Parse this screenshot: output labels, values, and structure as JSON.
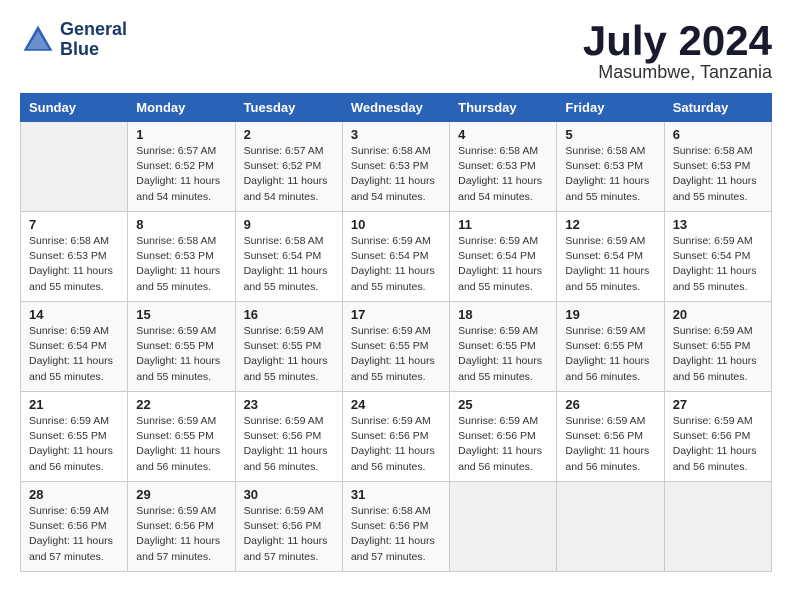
{
  "header": {
    "logo_line1": "General",
    "logo_line2": "Blue",
    "month_year": "July 2024",
    "location": "Masumbwe, Tanzania"
  },
  "calendar": {
    "days_of_week": [
      "Sunday",
      "Monday",
      "Tuesday",
      "Wednesday",
      "Thursday",
      "Friday",
      "Saturday"
    ],
    "weeks": [
      [
        {
          "day": "",
          "info": ""
        },
        {
          "day": "1",
          "info": "Sunrise: 6:57 AM\nSunset: 6:52 PM\nDaylight: 11 hours\nand 54 minutes."
        },
        {
          "day": "2",
          "info": "Sunrise: 6:57 AM\nSunset: 6:52 PM\nDaylight: 11 hours\nand 54 minutes."
        },
        {
          "day": "3",
          "info": "Sunrise: 6:58 AM\nSunset: 6:53 PM\nDaylight: 11 hours\nand 54 minutes."
        },
        {
          "day": "4",
          "info": "Sunrise: 6:58 AM\nSunset: 6:53 PM\nDaylight: 11 hours\nand 54 minutes."
        },
        {
          "day": "5",
          "info": "Sunrise: 6:58 AM\nSunset: 6:53 PM\nDaylight: 11 hours\nand 55 minutes."
        },
        {
          "day": "6",
          "info": "Sunrise: 6:58 AM\nSunset: 6:53 PM\nDaylight: 11 hours\nand 55 minutes."
        }
      ],
      [
        {
          "day": "7",
          "info": "Sunrise: 6:58 AM\nSunset: 6:53 PM\nDaylight: 11 hours\nand 55 minutes."
        },
        {
          "day": "8",
          "info": "Sunrise: 6:58 AM\nSunset: 6:53 PM\nDaylight: 11 hours\nand 55 minutes."
        },
        {
          "day": "9",
          "info": "Sunrise: 6:58 AM\nSunset: 6:54 PM\nDaylight: 11 hours\nand 55 minutes."
        },
        {
          "day": "10",
          "info": "Sunrise: 6:59 AM\nSunset: 6:54 PM\nDaylight: 11 hours\nand 55 minutes."
        },
        {
          "day": "11",
          "info": "Sunrise: 6:59 AM\nSunset: 6:54 PM\nDaylight: 11 hours\nand 55 minutes."
        },
        {
          "day": "12",
          "info": "Sunrise: 6:59 AM\nSunset: 6:54 PM\nDaylight: 11 hours\nand 55 minutes."
        },
        {
          "day": "13",
          "info": "Sunrise: 6:59 AM\nSunset: 6:54 PM\nDaylight: 11 hours\nand 55 minutes."
        }
      ],
      [
        {
          "day": "14",
          "info": "Sunrise: 6:59 AM\nSunset: 6:54 PM\nDaylight: 11 hours\nand 55 minutes."
        },
        {
          "day": "15",
          "info": "Sunrise: 6:59 AM\nSunset: 6:55 PM\nDaylight: 11 hours\nand 55 minutes."
        },
        {
          "day": "16",
          "info": "Sunrise: 6:59 AM\nSunset: 6:55 PM\nDaylight: 11 hours\nand 55 minutes."
        },
        {
          "day": "17",
          "info": "Sunrise: 6:59 AM\nSunset: 6:55 PM\nDaylight: 11 hours\nand 55 minutes."
        },
        {
          "day": "18",
          "info": "Sunrise: 6:59 AM\nSunset: 6:55 PM\nDaylight: 11 hours\nand 55 minutes."
        },
        {
          "day": "19",
          "info": "Sunrise: 6:59 AM\nSunset: 6:55 PM\nDaylight: 11 hours\nand 56 minutes."
        },
        {
          "day": "20",
          "info": "Sunrise: 6:59 AM\nSunset: 6:55 PM\nDaylight: 11 hours\nand 56 minutes."
        }
      ],
      [
        {
          "day": "21",
          "info": "Sunrise: 6:59 AM\nSunset: 6:55 PM\nDaylight: 11 hours\nand 56 minutes."
        },
        {
          "day": "22",
          "info": "Sunrise: 6:59 AM\nSunset: 6:55 PM\nDaylight: 11 hours\nand 56 minutes."
        },
        {
          "day": "23",
          "info": "Sunrise: 6:59 AM\nSunset: 6:56 PM\nDaylight: 11 hours\nand 56 minutes."
        },
        {
          "day": "24",
          "info": "Sunrise: 6:59 AM\nSunset: 6:56 PM\nDaylight: 11 hours\nand 56 minutes."
        },
        {
          "day": "25",
          "info": "Sunrise: 6:59 AM\nSunset: 6:56 PM\nDaylight: 11 hours\nand 56 minutes."
        },
        {
          "day": "26",
          "info": "Sunrise: 6:59 AM\nSunset: 6:56 PM\nDaylight: 11 hours\nand 56 minutes."
        },
        {
          "day": "27",
          "info": "Sunrise: 6:59 AM\nSunset: 6:56 PM\nDaylight: 11 hours\nand 56 minutes."
        }
      ],
      [
        {
          "day": "28",
          "info": "Sunrise: 6:59 AM\nSunset: 6:56 PM\nDaylight: 11 hours\nand 57 minutes."
        },
        {
          "day": "29",
          "info": "Sunrise: 6:59 AM\nSunset: 6:56 PM\nDaylight: 11 hours\nand 57 minutes."
        },
        {
          "day": "30",
          "info": "Sunrise: 6:59 AM\nSunset: 6:56 PM\nDaylight: 11 hours\nand 57 minutes."
        },
        {
          "day": "31",
          "info": "Sunrise: 6:58 AM\nSunset: 6:56 PM\nDaylight: 11 hours\nand 57 minutes."
        },
        {
          "day": "",
          "info": ""
        },
        {
          "day": "",
          "info": ""
        },
        {
          "day": "",
          "info": ""
        }
      ]
    ]
  }
}
